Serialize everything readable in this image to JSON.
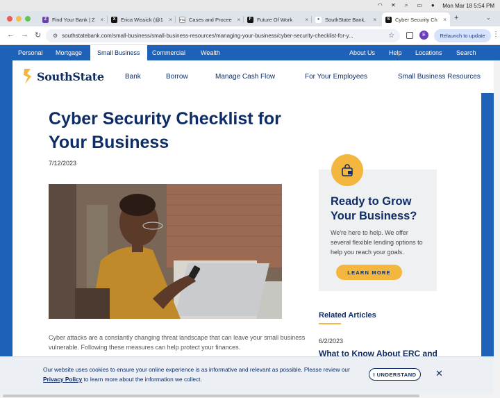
{
  "menubar": {
    "datetime": "Mon Mar 18  5:54 PM"
  },
  "tabs": [
    {
      "title": "Find Your Bank | Z",
      "favicon_color": "#6a3fb5",
      "favicon_glyph": "Z"
    },
    {
      "title": "Erica Wissick (@1",
      "favicon_color": "#111111",
      "favicon_glyph": "X"
    },
    {
      "title": "Cases and Procee",
      "favicon_color": "#ffffff",
      "favicon_glyph": "FTC"
    },
    {
      "title": "Future Of Work",
      "favicon_color": "#111111",
      "favicon_glyph": "F"
    },
    {
      "title": "SouthState Bank,",
      "favicon_color": "#ffffff",
      "favicon_glyph": "person-icon"
    },
    {
      "title": "Cyber Security Ch",
      "favicon_color": "#111111",
      "favicon_glyph": "S"
    }
  ],
  "toolbar": {
    "url": "southstatebank.com/small-business/small-business-resources/managing-your-business/cyber-security-checklist-for-y...",
    "profile_initial": "E",
    "relaunch_label": "Relaunch to update"
  },
  "site_nav": {
    "left": [
      "Personal",
      "Mortgage",
      "Small Business",
      "Commercial",
      "Wealth"
    ],
    "right": [
      "About Us",
      "Help",
      "Locations",
      "Search"
    ],
    "active": "Small Business"
  },
  "brand": {
    "name": "SouthState",
    "accent": "#f3b73f",
    "navy": "#0e2d66",
    "blue": "#1d61b9"
  },
  "main_nav": [
    "Bank",
    "Borrow",
    "Manage Cash Flow",
    "For Your Employees",
    "Small Business Resources"
  ],
  "article": {
    "title": "Cyber Security Checklist for Your Business",
    "date": "7/12/2023",
    "intro": "Cyber attacks are a constantly changing threat landscape that can leave your small business vulnerable. Following these measures can help protect your finances."
  },
  "promo": {
    "title": "Ready to Grow Your Business?",
    "text": "We're here to help. We offer several flexible lending options to help you reach your goals.",
    "button": "LEARN MORE"
  },
  "related": {
    "heading": "Related Articles",
    "items": [
      {
        "date": "6/2/2023",
        "title": "What to Know About ERC and"
      }
    ]
  },
  "cookie": {
    "text": "Our website uses cookies to ensure your online experience is as informative and relevant as possible. Please review our",
    "link": "Privacy Policy",
    "text_after": "to learn more about the information we collect.",
    "button": "I UNDERSTAND"
  }
}
